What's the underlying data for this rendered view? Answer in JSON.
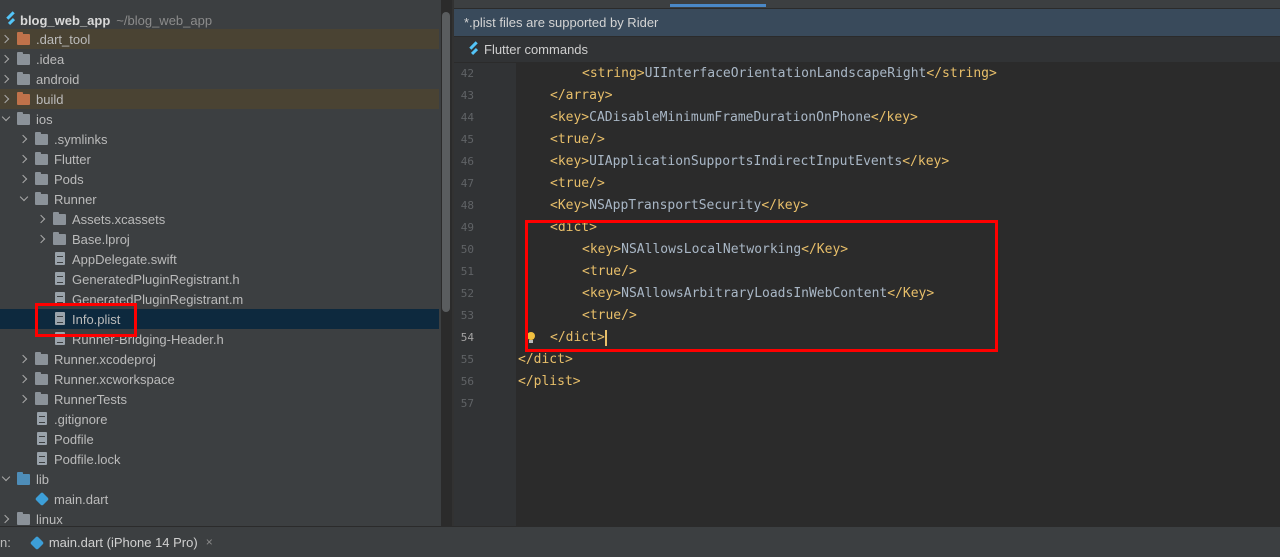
{
  "project": {
    "name": "blog_web_app",
    "path": "~/blog_web_app"
  },
  "tree": [
    {
      "label": ".dart_tool",
      "arrow": "closed",
      "icon": "folder",
      "color": "orange",
      "level": 0,
      "excluded": true
    },
    {
      "label": ".idea",
      "arrow": "closed",
      "icon": "folder-settings",
      "color": "grey",
      "level": 0
    },
    {
      "label": "android",
      "arrow": "closed",
      "icon": "folder",
      "color": "grey",
      "level": 0
    },
    {
      "label": "build",
      "arrow": "closed",
      "icon": "folder",
      "color": "orange",
      "level": 0,
      "excluded": true
    },
    {
      "label": "ios",
      "arrow": "open",
      "icon": "folder",
      "color": "grey",
      "level": 0
    },
    {
      "label": ".symlinks",
      "arrow": "closed",
      "icon": "folder",
      "color": "grey",
      "level": 1
    },
    {
      "label": "Flutter",
      "arrow": "closed",
      "icon": "folder",
      "color": "grey",
      "level": 1
    },
    {
      "label": "Pods",
      "arrow": "closed",
      "icon": "folder",
      "color": "grey",
      "level": 1
    },
    {
      "label": "Runner",
      "arrow": "open",
      "icon": "folder",
      "color": "grey",
      "level": 1
    },
    {
      "label": "Assets.xcassets",
      "arrow": "closed",
      "icon": "folder",
      "color": "grey",
      "level": 2
    },
    {
      "label": "Base.lproj",
      "arrow": "closed",
      "icon": "folder",
      "color": "grey",
      "level": 2
    },
    {
      "label": "AppDelegate.swift",
      "arrow": "none",
      "icon": "file",
      "level": 2
    },
    {
      "label": "GeneratedPluginRegistrant.h",
      "arrow": "none",
      "icon": "hfile",
      "level": 2
    },
    {
      "label": "GeneratedPluginRegistrant.m",
      "arrow": "none",
      "icon": "hfile",
      "level": 2
    },
    {
      "label": "Info.plist",
      "arrow": "none",
      "icon": "file",
      "level": 2,
      "selected": true
    },
    {
      "label": "Runner-Bridging-Header.h",
      "arrow": "none",
      "icon": "hfile",
      "level": 2
    },
    {
      "label": "Runner.xcodeproj",
      "arrow": "closed",
      "icon": "folder",
      "color": "grey",
      "level": 1
    },
    {
      "label": "Runner.xcworkspace",
      "arrow": "closed",
      "icon": "folder",
      "color": "grey",
      "level": 1
    },
    {
      "label": "RunnerTests",
      "arrow": "closed",
      "icon": "folder",
      "color": "grey",
      "level": 1
    },
    {
      "label": ".gitignore",
      "arrow": "none",
      "icon": "file",
      "level": 1
    },
    {
      "label": "Podfile",
      "arrow": "none",
      "icon": "file",
      "level": 1
    },
    {
      "label": "Podfile.lock",
      "arrow": "none",
      "icon": "file",
      "level": 1
    },
    {
      "label": "lib",
      "arrow": "open",
      "icon": "folder",
      "color": "blue",
      "level": 0
    },
    {
      "label": "main.dart",
      "arrow": "none",
      "icon": "dart",
      "level": 1
    },
    {
      "label": "linux",
      "arrow": "closed",
      "icon": "folder",
      "color": "grey",
      "level": 0
    }
  ],
  "notification": "*.plist files are supported by Rider",
  "flutter_commands": "Flutter commands",
  "code_lines": [
    {
      "n": "42",
      "indent": 2,
      "parts": [
        [
          "tag",
          "<string>"
        ],
        [
          "text",
          "UIInterfaceOrientationLandscapeRight"
        ],
        [
          "tag",
          "</string>"
        ]
      ]
    },
    {
      "n": "43",
      "indent": 1,
      "parts": [
        [
          "tag",
          "</array>"
        ]
      ]
    },
    {
      "n": "44",
      "indent": 1,
      "parts": [
        [
          "tag",
          "<key>"
        ],
        [
          "text",
          "CADisableMinimumFrameDurationOnPhone"
        ],
        [
          "tag",
          "</key>"
        ]
      ]
    },
    {
      "n": "45",
      "indent": 1,
      "parts": [
        [
          "tag",
          "<true/>"
        ]
      ]
    },
    {
      "n": "46",
      "indent": 1,
      "parts": [
        [
          "tag",
          "<key>"
        ],
        [
          "text",
          "UIApplicationSupportsIndirectInputEvents"
        ],
        [
          "tag",
          "</key>"
        ]
      ]
    },
    {
      "n": "47",
      "indent": 1,
      "parts": [
        [
          "tag",
          "<true/>"
        ]
      ]
    },
    {
      "n": "48",
      "indent": 1,
      "parts": [
        [
          "tag",
          "<Key>"
        ],
        [
          "text",
          "NSAppTransportSecurity"
        ],
        [
          "tag",
          "</key>"
        ]
      ]
    },
    {
      "n": "49",
      "indent": 1,
      "parts": [
        [
          "tag",
          "<dict>"
        ]
      ]
    },
    {
      "n": "50",
      "indent": 2,
      "parts": [
        [
          "tag",
          "<key>"
        ],
        [
          "text",
          "NSAllowsLocalNetworking"
        ],
        [
          "tag",
          "</Key>"
        ]
      ]
    },
    {
      "n": "51",
      "indent": 2,
      "parts": [
        [
          "tag",
          "<true/>"
        ]
      ]
    },
    {
      "n": "52",
      "indent": 2,
      "parts": [
        [
          "tag",
          "<key>"
        ],
        [
          "text",
          "NSAllowsArbitraryLoadsInWebContent"
        ],
        [
          "tag",
          "</Key>"
        ]
      ]
    },
    {
      "n": "53",
      "indent": 2,
      "parts": [
        [
          "tag",
          "<true/>"
        ]
      ]
    },
    {
      "n": "54",
      "indent": 1,
      "parts": [
        [
          "tag",
          "</dict>"
        ]
      ],
      "current": true,
      "bulb": true,
      "caret": true
    },
    {
      "n": "55",
      "indent": 0,
      "parts": [
        [
          "tag",
          "</dict>"
        ]
      ]
    },
    {
      "n": "56",
      "indent": 0,
      "parts": [
        [
          "tag",
          "</plist>"
        ]
      ]
    },
    {
      "n": "57",
      "indent": 0,
      "parts": []
    }
  ],
  "bottom_bar": {
    "prefix": "n:",
    "run_tab": "main.dart (iPhone 14 Pro)",
    "close": "×"
  },
  "colors": {
    "highlight_box": "#ff0000",
    "selection": "#0d293e",
    "tag": "#e8bf6a",
    "text": "#a9b7c6"
  }
}
